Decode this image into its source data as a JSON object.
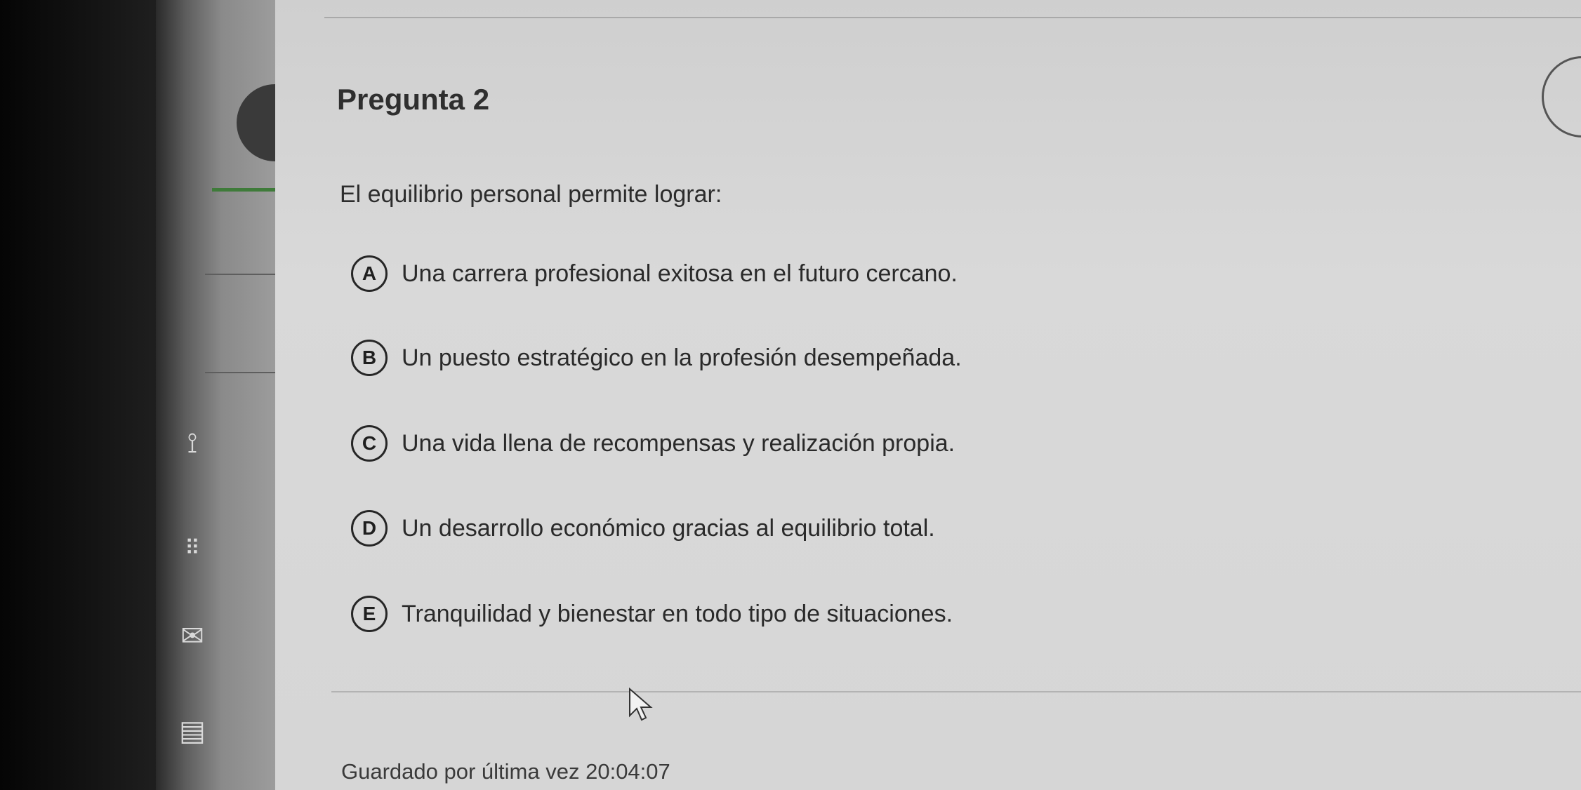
{
  "question": {
    "title": "Pregunta 2",
    "prompt": "El equilibrio personal permite lograr:",
    "options": [
      {
        "letter": "A",
        "text": "Una carrera profesional exitosa en el futuro cercano."
      },
      {
        "letter": "B",
        "text": "Un puesto estratégico en la profesión desempeñada."
      },
      {
        "letter": "C",
        "text": "Una vida llena de recompensas y realización propia."
      },
      {
        "letter": "D",
        "text": "Un desarrollo económico gracias al equilibrio total."
      },
      {
        "letter": "E",
        "text": "Tranquilidad y bienestar en todo tipo de situaciones."
      }
    ]
  },
  "footer": {
    "saved_label": "Guardado por última vez",
    "saved_time": "20:04:07"
  },
  "sidebar": {
    "icons": [
      "flowchart-icon",
      "keypad-icon",
      "mail-icon",
      "document-icon"
    ]
  },
  "colors": {
    "panel_bg": "#d6d6d6",
    "text": "#2a2a2a",
    "accent_green": "#3f7b3a"
  }
}
